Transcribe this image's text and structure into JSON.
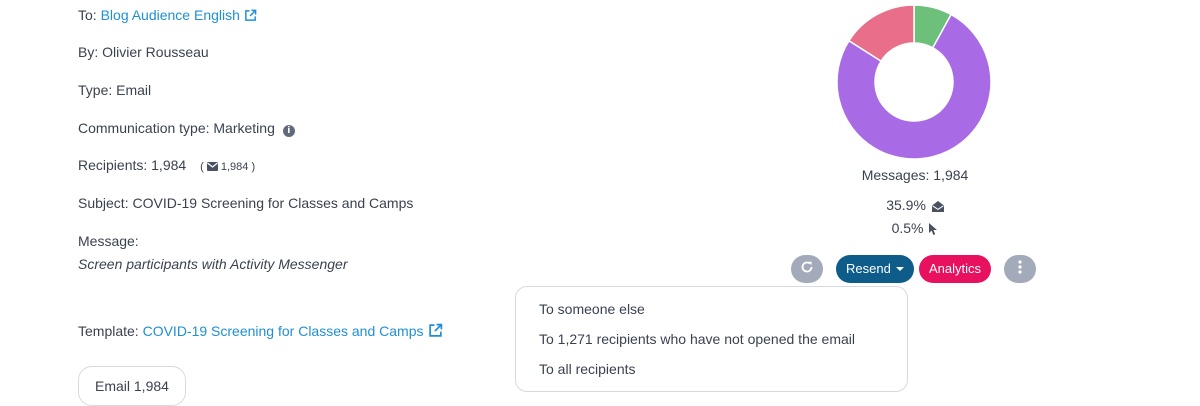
{
  "details": {
    "to_label": "To:",
    "to_value": "Blog Audience English",
    "by": "By: Olivier Rousseau",
    "type": "Type: Email",
    "communication_type": "Communication type: Marketing",
    "recipients_label": "Recipients: 1,984",
    "recipients_email_open": "(",
    "recipients_email_count": "1,984",
    "recipients_email_close": ")",
    "subject": "Subject: COVID-19 Screening for Classes and Camps",
    "message_label": "Message:",
    "message_value": "Screen participants with Activity Messenger",
    "template_label": "Template:",
    "template_value": "COVID-19 Screening for Classes and Camps"
  },
  "tab_chip": {
    "label": "Email 1,984"
  },
  "stats": {
    "messages": "Messages: 1,984",
    "open_rate": "35.9%",
    "click_rate": "0.5%"
  },
  "chart_data": {
    "type": "pie",
    "donut": true,
    "slices": [
      {
        "value": 8,
        "color": "#6cc07a"
      },
      {
        "value": 76,
        "color": "#a96ae6"
      },
      {
        "value": 16,
        "color": "#e86e8a"
      }
    ]
  },
  "actions": {
    "resend_label": "Resend",
    "analytics_label": "Analytics"
  },
  "resend_menu": {
    "items": [
      "To someone else",
      "To 1,271 recipients who have not opened the email",
      "To all recipients"
    ]
  },
  "colors": {
    "link": "#1f8fd6",
    "resend": "#0d5c8a",
    "analytics": "#e8115f",
    "gray_button": "#a3abbb"
  }
}
